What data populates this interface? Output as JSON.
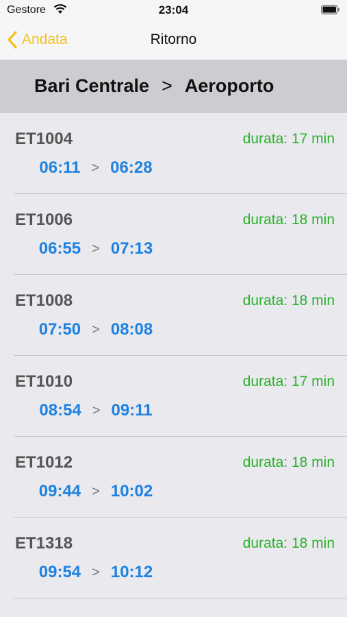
{
  "status_bar": {
    "carrier": "Gestore",
    "time": "23:04"
  },
  "nav": {
    "back_label": "Andata",
    "title": "Ritorno"
  },
  "route": {
    "from": "Bari Centrale",
    "separator": ">",
    "to": "Aeroporto"
  },
  "trips": [
    {
      "code": "ET1004",
      "duration": "durata: 17 min",
      "depart": "06:11",
      "arrow": ">",
      "arrive": "06:28"
    },
    {
      "code": "ET1006",
      "duration": "durata: 18 min",
      "depart": "06:55",
      "arrow": ">",
      "arrive": "07:13"
    },
    {
      "code": "ET1008",
      "duration": "durata: 18 min",
      "depart": "07:50",
      "arrow": ">",
      "arrive": "08:08"
    },
    {
      "code": "ET1010",
      "duration": "durata: 17 min",
      "depart": "08:54",
      "arrow": ">",
      "arrive": "09:11"
    },
    {
      "code": "ET1012",
      "duration": "durata: 18 min",
      "depart": "09:44",
      "arrow": ">",
      "arrive": "10:02"
    },
    {
      "code": "ET1318",
      "duration": "durata: 18 min",
      "depart": "09:54",
      "arrow": ">",
      "arrive": "10:12"
    }
  ],
  "colors": {
    "accent": "#f5bf1b",
    "time_blue": "#1e82e0",
    "duration_green": "#29b12a"
  }
}
